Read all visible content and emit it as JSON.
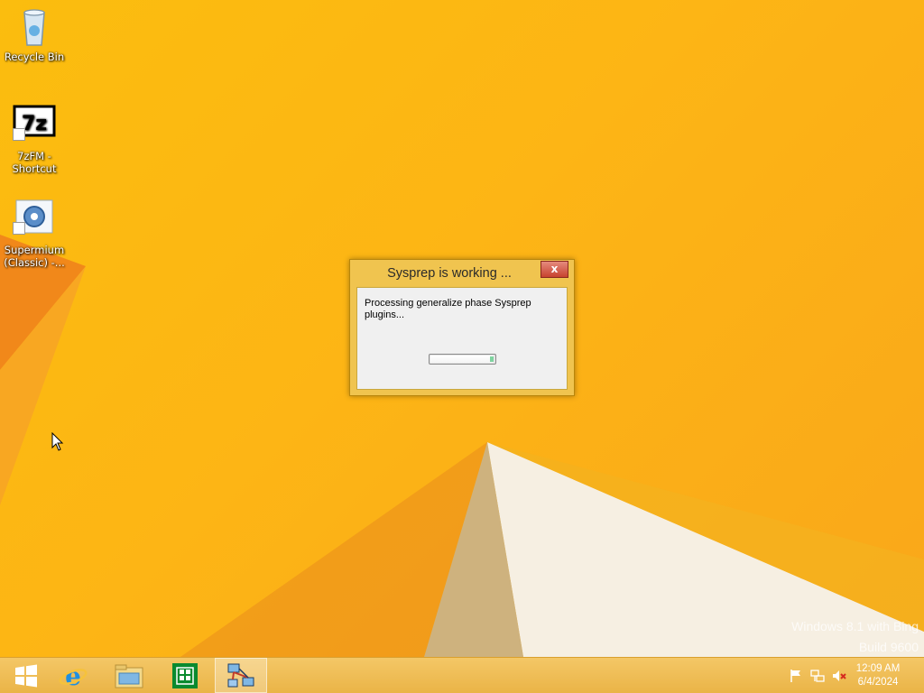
{
  "desktop": {
    "icons": [
      {
        "label": "Recycle Bin",
        "icon": "recycle-bin-icon"
      },
      {
        "label": "7zFM -\nShortcut",
        "icon": "7zip-icon"
      },
      {
        "label": "Supermium\n(Classic) -...",
        "icon": "supermium-gear-icon"
      }
    ],
    "watermark": {
      "line1": "Windows 8.1 with Bing",
      "line2": "Build 9600"
    }
  },
  "dialog": {
    "title": "Sysprep is working ...",
    "close_label": "x",
    "message": "Processing generalize phase Sysprep plugins...",
    "progress": 0.97
  },
  "taskbar": {
    "apps": [
      {
        "name": "start",
        "icon": "windows-logo-icon"
      },
      {
        "name": "internet-explorer",
        "icon": "ie-icon"
      },
      {
        "name": "file-explorer",
        "icon": "folder-icon"
      },
      {
        "name": "store",
        "icon": "store-icon"
      },
      {
        "name": "network-app",
        "icon": "network-computers-icon",
        "active": true
      }
    ],
    "tray": {
      "icons": [
        "flag-icon",
        "network-icon",
        "speaker-muted-icon"
      ]
    },
    "clock": {
      "time": "12:09 AM",
      "date": "6/4/2024"
    }
  }
}
